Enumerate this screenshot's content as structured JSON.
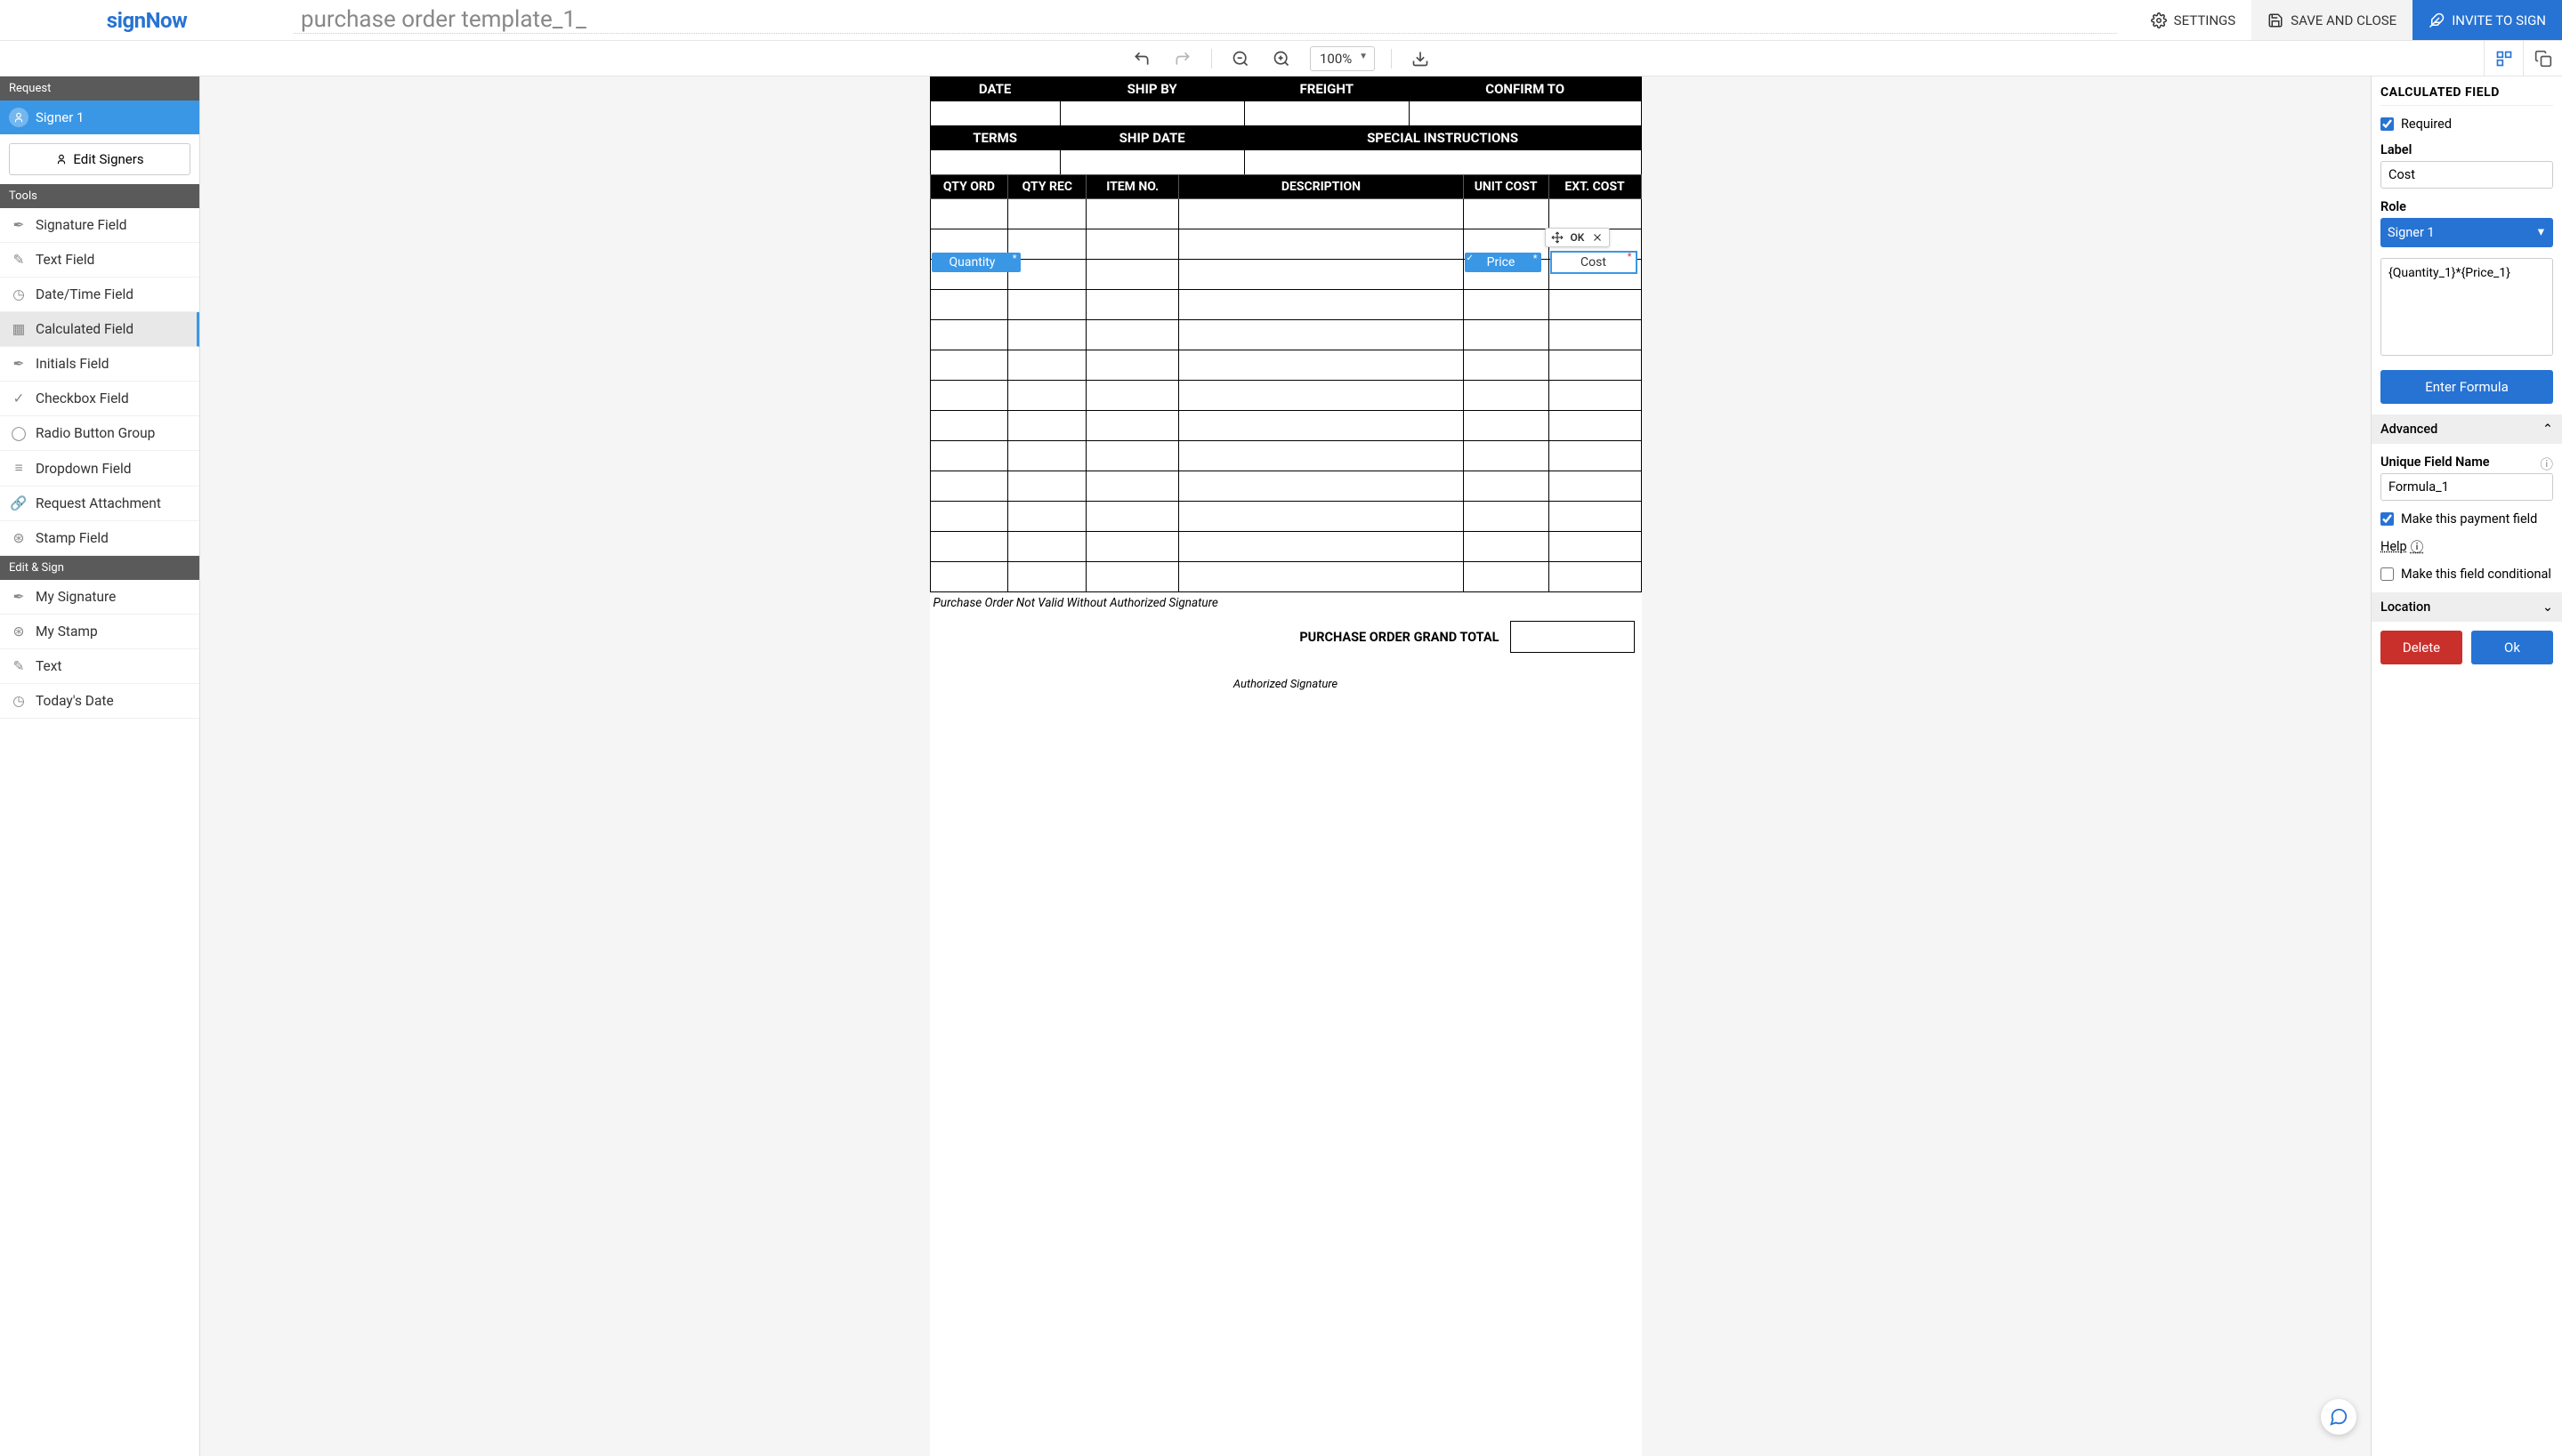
{
  "logo": "signNow",
  "doc_title": "purchase order template_1_",
  "header_buttons": {
    "settings": "SETTINGS",
    "save": "SAVE AND CLOSE",
    "invite": "INVITE TO SIGN"
  },
  "toolbar": {
    "zoom": "100%"
  },
  "sidebar_left": {
    "request_header": "Request",
    "signer": "Signer 1",
    "edit_signers": "Edit Signers",
    "tools_header": "Tools",
    "tools": [
      {
        "label": "Signature Field"
      },
      {
        "label": "Text Field"
      },
      {
        "label": "Date/Time Field"
      },
      {
        "label": "Calculated Field",
        "active": true
      },
      {
        "label": "Initials Field"
      },
      {
        "label": "Checkbox Field"
      },
      {
        "label": "Radio Button Group"
      },
      {
        "label": "Dropdown Field"
      },
      {
        "label": "Request Attachment"
      },
      {
        "label": "Stamp Field"
      }
    ],
    "edit_sign_header": "Edit & Sign",
    "edit_sign": [
      {
        "label": "My Signature"
      },
      {
        "label": "My Stamp"
      },
      {
        "label": "Text"
      },
      {
        "label": "Today's Date"
      }
    ]
  },
  "po": {
    "row1": [
      "DATE",
      "SHIP BY",
      "FREIGHT",
      "CONFIRM TO"
    ],
    "row2": [
      "TERMS",
      "SHIP DATE",
      "SPECIAL INSTRUCTIONS"
    ],
    "cols": [
      "QTY ORD",
      "QTY REC",
      "ITEM NO.",
      "DESCRIPTION",
      "UNIT COST",
      "EXT. COST"
    ],
    "note": "Purchase Order Not Valid Without Authorized Signature",
    "grand_total": "PURCHASE ORDER GRAND TOTAL",
    "auth_sig": "Authorized Signature"
  },
  "placed_fields": {
    "quantity": "Quantity",
    "price": "Price",
    "cost": "Cost",
    "ok": "OK"
  },
  "sidebar_right": {
    "title": "CALCULATED FIELD",
    "required_label": "Required",
    "label_label": "Label",
    "label_value": "Cost",
    "role_label": "Role",
    "role_value": "Signer 1",
    "formula_value": "{Quantity_1}*{Price_1}",
    "enter_formula": "Enter Formula",
    "advanced": "Advanced",
    "unique_field_label": "Unique Field Name",
    "unique_field_value": "Formula_1",
    "payment_checkbox": "Make this payment field",
    "help": "Help",
    "conditional_checkbox": "Make this field conditional",
    "location": "Location",
    "delete": "Delete",
    "ok": "Ok"
  }
}
